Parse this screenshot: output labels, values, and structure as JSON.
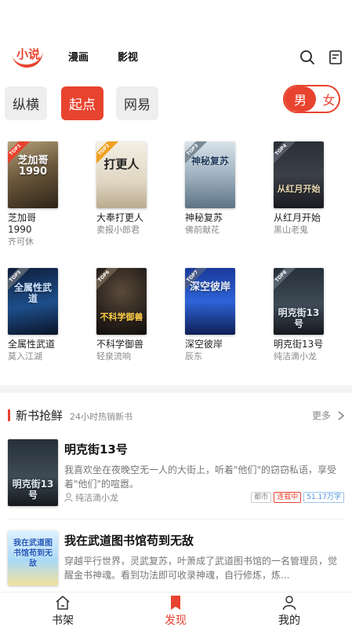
{
  "topnav": {
    "tabs": [
      {
        "label": "小说"
      },
      {
        "label": "漫画"
      },
      {
        "label": "影视"
      }
    ],
    "icons": [
      "search-icon",
      "history-icon"
    ],
    "accent": "#e8432f"
  },
  "sources": {
    "items": [
      "纵横",
      "起点",
      "网易"
    ],
    "selected": "起点"
  },
  "gender": {
    "male": "男",
    "female": "女",
    "selected": "男"
  },
  "grid_books": [
    {
      "name": "芝加哥1990",
      "author": "齐可休",
      "rank": "TOP1",
      "cover_text": "芝加哥1990"
    },
    {
      "name": "大奉打更人",
      "author": "卖报小郎君",
      "rank": "TOP2",
      "cover_text": "打更人"
    },
    {
      "name": "神秘复苏",
      "author": "佛前献花",
      "rank": "TOP3",
      "cover_text": "神秘复苏"
    },
    {
      "name": "从红月开始",
      "author": "黑山老鬼",
      "rank": "TOP4",
      "cover_text": "从红月开始"
    },
    {
      "name": "全属性武道",
      "author": "莫入江湖",
      "rank": "TOP5",
      "cover_text": "全属性武道"
    },
    {
      "name": "不科学御兽",
      "author": "轻泉流响",
      "rank": "TOP6",
      "cover_text": "不科学御兽"
    },
    {
      "name": "深空彼岸",
      "author": "辰东",
      "rank": "TOP7",
      "cover_text": "深空彼岸"
    },
    {
      "name": "明克街13号",
      "author": "纯洁滴小龙",
      "rank": "TOP8",
      "cover_text": "明克街13号"
    }
  ],
  "section": {
    "title": "新书抢鲜",
    "subtitle": "24小时热销新书",
    "more": "更多"
  },
  "list_items": [
    {
      "title": "明克街13号",
      "desc": "我喜欢坐在夜晚空无一人的大街上，听着\"他们\"的窃窃私语，享受着\"他们\"的喧嚣。",
      "author": "纯洁滴小龙",
      "tags": [
        "都市",
        "连载中",
        "51.17万字"
      ],
      "cover_text": "明克街13号"
    },
    {
      "title": "我在武道图书馆苟到无敌",
      "desc": "穿越平行世界，灵武复苏，叶萧成了武道图书馆的一名管理员，觉醒金书神魂。看到功法即可收录神魂，自行修炼，炼...",
      "cover_text": "我在武道图书馆苟到无敌"
    }
  ],
  "bottombar": {
    "items": [
      {
        "label": "书架",
        "icon": "home-icon"
      },
      {
        "label": "发现",
        "icon": "bookmark-icon"
      },
      {
        "label": "我的",
        "icon": "user-icon"
      }
    ],
    "active": "发现"
  }
}
